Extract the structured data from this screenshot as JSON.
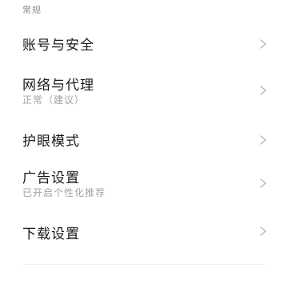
{
  "section": {
    "label": "常规"
  },
  "items": [
    {
      "title": "账号与安全",
      "subtitle": ""
    },
    {
      "title": "网络与代理",
      "subtitle": "正常（建议）"
    },
    {
      "title": "护眼模式",
      "subtitle": ""
    },
    {
      "title": "广告设置",
      "subtitle": "已开启个性化推荐"
    },
    {
      "title": "下载设置",
      "subtitle": ""
    }
  ],
  "colors": {
    "text": "#1a1a1a",
    "secondary": "#a3a3a3",
    "chevron": "#b5b5b5"
  },
  "icons": {
    "chevron": "chevron-right-icon"
  }
}
